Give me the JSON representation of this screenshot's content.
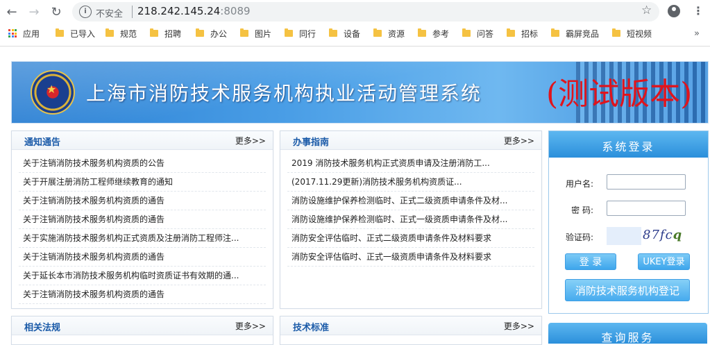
{
  "browser": {
    "security_label": "不安全",
    "url_host": "218.242.145.24",
    "url_port": ":8089",
    "bookmarks": [
      "应用",
      "已导入",
      "规范",
      "招聘",
      "办公",
      "图片",
      "同行",
      "设备",
      "资源",
      "参考",
      "问答",
      "招标",
      "霸屏竞品",
      "短视频"
    ],
    "more_bookmarks": "»"
  },
  "banner": {
    "title": "上海市消防技术服务机构执业活动管理系统",
    "test_label": "(测试版本)"
  },
  "notices": {
    "title": "通知通告",
    "more": "更多>>",
    "items": [
      "关于注销消防技术服务机构资质的公告",
      "关于开展注册消防工程师继续教育的通知",
      "关于注销消防技术服务机构资质的通告",
      "关于注销消防技术服务机构资质的通告",
      "关于实施消防技术服务机构正式资质及注册消防工程师注...",
      "关于注销消防技术服务机构资质的通告",
      "关于延长本市消防技术服务机构临时资质证书有效期的通...",
      "关于注销消防技术服务机构资质的通告"
    ]
  },
  "guide": {
    "title": "办事指南",
    "more": "更多>>",
    "items": [
      "2019 消防技术服务机构正式资质申请及注册消防工...",
      "(2017.11.29更新)消防技术服务机构资质证...",
      "消防设施维护保养检测临时、正式二级资质申请条件及材...",
      "消防设施维护保养检测临时、正式一级资质申请条件及材...",
      "消防安全评估临时、正式二级资质申请条件及材料要求",
      "消防安全评估临时、正式一级资质申请条件及材料要求"
    ]
  },
  "laws": {
    "title": "相关法规",
    "more": "更多>>"
  },
  "standards": {
    "title": "技术标准",
    "more": "更多>>"
  },
  "login": {
    "title": "系统登录",
    "username_label": "用户名:",
    "password_label": "密 码:",
    "captcha_label": "验证码:",
    "captcha_text": "87fc",
    "captcha_tail": "q",
    "login_button": "登 录",
    "ukey_button": "UKEY登录",
    "register_button": "消防技术服务机构登记"
  },
  "query": {
    "title": "查询服务"
  },
  "colors": {
    "accent": "#2b8fdb",
    "title_blue": "#1a5aa8",
    "test_red": "#e0141c"
  }
}
